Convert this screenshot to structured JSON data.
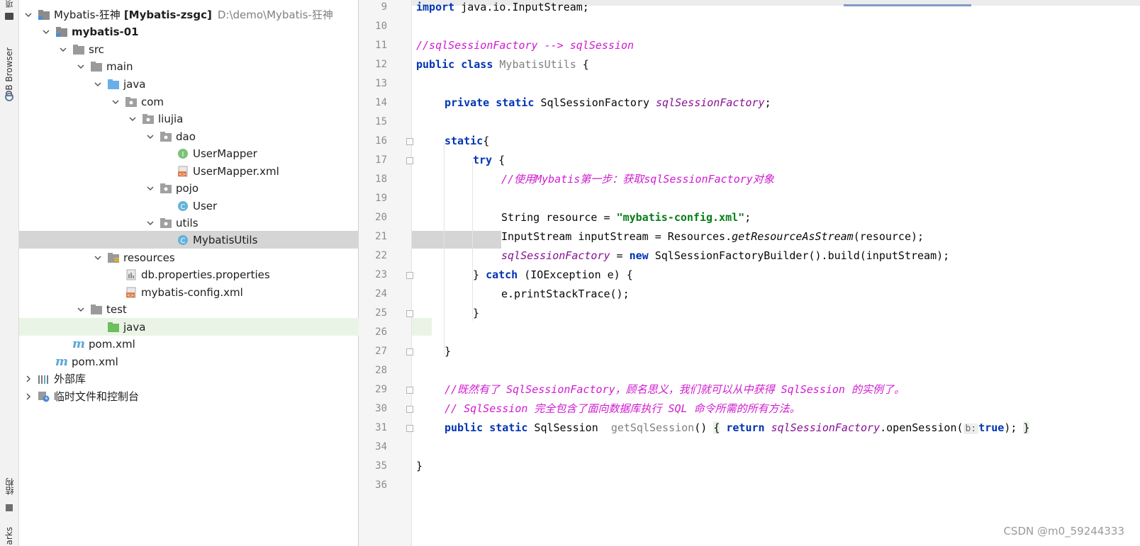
{
  "side_strip": {
    "project_label": "项",
    "db_browser_label": "DB Browser",
    "structure_label": "结构",
    "bookmarks_label": "arks"
  },
  "tree": {
    "root_name": "Mybatis-狂神",
    "root_module": "[Mybatis-zsgc]",
    "root_path": "D:\\demo\\Mybatis-狂神",
    "rows": [
      {
        "label": "mybatis-01"
      },
      {
        "label": "src"
      },
      {
        "label": "main"
      },
      {
        "label": "java"
      },
      {
        "label": "com"
      },
      {
        "label": "liujia"
      },
      {
        "label": "dao"
      },
      {
        "label": "UserMapper"
      },
      {
        "label": "UserMapper.xml"
      },
      {
        "label": "pojo"
      },
      {
        "label": "User"
      },
      {
        "label": "utils"
      },
      {
        "label": "MybatisUtils"
      },
      {
        "label": "resources"
      },
      {
        "label": "db.properties.properties"
      },
      {
        "label": "mybatis-config.xml"
      },
      {
        "label": "test"
      },
      {
        "label": "java"
      },
      {
        "label": "pom.xml"
      },
      {
        "label": "pom.xml"
      },
      {
        "label": "外部库"
      },
      {
        "label": "临时文件和控制台"
      }
    ]
  },
  "editor": {
    "line_numbers": [
      "9",
      "10",
      "11",
      "12",
      "13",
      "14",
      "15",
      "16",
      "17",
      "18",
      "19",
      "20",
      "21",
      "22",
      "23",
      "24",
      "25",
      "26",
      "27",
      "28",
      "29",
      "30",
      "31",
      "34",
      "35",
      "36"
    ],
    "code": {
      "l9_kw": "import",
      "l9_rest": " java.io.InputStream;",
      "l11_comment": "//sqlSessionFactory --> sqlSession",
      "l12_kw": "public class",
      "l12_name": " MybatisUtils",
      "l12_rest": " {",
      "l14_kw": "private static",
      "l14_type": " SqlSessionFactory ",
      "l14_field": "sqlSessionFactory",
      "l14_rest": ";",
      "l16_kw": "static",
      "l16_rest": "{",
      "l17_kw": "try",
      "l17_rest": " {",
      "l18_comment": "//使用Mybatis第一步：获取sqlSessionFactory对象",
      "l20_pre": "String resource = ",
      "l20_str": "\"mybatis-config.xml\"",
      "l20_post": ";",
      "l21_pre": "InputStream inputStream = Resources.",
      "l21_method": "getResourceAsStream",
      "l21_post": "(resource);",
      "l22_field": "sqlSessionFactory",
      "l22_mid": " = ",
      "l22_kw": "new",
      "l22_post": " SqlSessionFactoryBuilder().build(inputStream);",
      "l23_pre": "} ",
      "l23_kw": "catch",
      "l23_post": " (IOException e) {",
      "l24_text": "e.printStackTrace();",
      "l25_text": "}",
      "l27_text": "}",
      "l29_comment": "//既然有了 SqlSessionFactory，顾名思义，我们就可以从中获得 SqlSession 的实例了。",
      "l30_comment": "// SqlSession 完全包含了面向数据库执行 SQL 命令所需的所有方法。",
      "l31_kw": "public static",
      "l31_type": " SqlSession  ",
      "l31_method": "getSqlSession",
      "l31_paren": "()",
      "l31_open": "{",
      "l31_ret": "return",
      "l31_field": "sqlSessionFactory",
      "l31_call": ".openSession(",
      "l31_hint": "b:",
      "l31_true": "true",
      "l31_end": ");",
      "l31_close": "}",
      "l35_text": "}"
    }
  },
  "watermark": "CSDN @m0_59244333"
}
